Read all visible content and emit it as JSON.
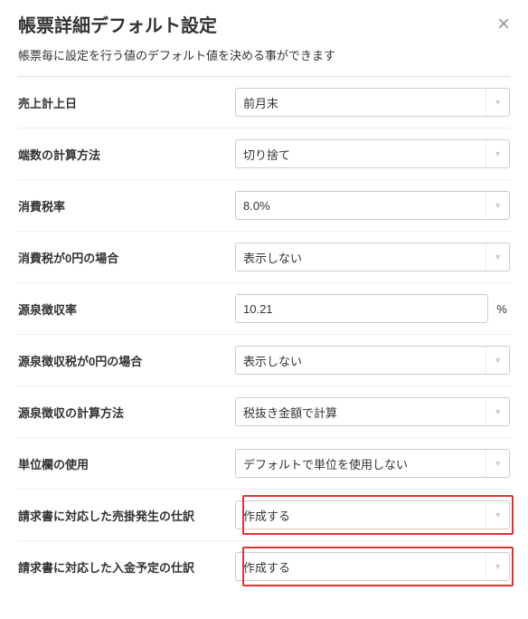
{
  "header": {
    "title": "帳票詳細デフォルト設定"
  },
  "description": "帳票毎に設定を行う値のデフォルト値を決める事ができます",
  "rows": {
    "sales_date": {
      "label": "売上計上日",
      "value": "前月末"
    },
    "rounding": {
      "label": "端数の計算方法",
      "value": "切り捨て"
    },
    "tax_rate": {
      "label": "消費税率",
      "value": "8.0%"
    },
    "tax_zero": {
      "label": "消費税が0円の場合",
      "value": "表示しない"
    },
    "withholding_rate": {
      "label": "源泉徴収率",
      "value": "10.21",
      "suffix": "%"
    },
    "withholding_zero": {
      "label": "源泉徴収税が0円の場合",
      "value": "表示しない"
    },
    "withholding_calc": {
      "label": "源泉徴収の計算方法",
      "value": "税抜き金額で計算"
    },
    "unit_column": {
      "label": "単位欄の使用",
      "value": "デフォルトで単位を使用しない"
    },
    "ar_journal": {
      "label": "請求書に対応した売掛発生の仕訳",
      "value": "作成する"
    },
    "payment_journal": {
      "label": "請求書に対応した入金予定の仕訳",
      "value": "作成する"
    }
  }
}
